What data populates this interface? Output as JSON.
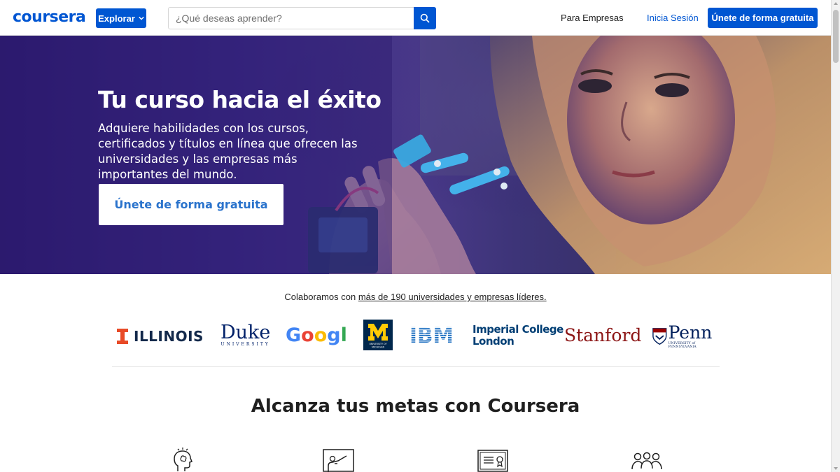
{
  "header": {
    "logo_text": "coursera",
    "explore_label": "Explorar",
    "search_placeholder": "¿Qué deseas aprender?",
    "nav_business": "Para Empresas",
    "nav_login": "Inicia Sesión",
    "join_label": "Únete de forma gratuita"
  },
  "hero": {
    "title": "Tu curso hacia el éxito",
    "subtitle": "Adquiere habilidades con los cursos, certificados y títulos en línea que ofrecen las universidades y las empresas más importantes del mundo.",
    "cta_label": "Únete de forma gratuita"
  },
  "partners": {
    "intro": "Colaboramos con ",
    "link_text": "más de 190 universidades y empresas líderes.",
    "logos": [
      {
        "name": "illinois",
        "text": "ILLINOIS",
        "mark": "I"
      },
      {
        "name": "duke",
        "text": "Duke",
        "subtext": "UNIVERSITY"
      },
      {
        "name": "google",
        "text": "Google"
      },
      {
        "name": "michigan",
        "mark": "M",
        "subtext": "UNIVERSITY OF MICHIGAN"
      },
      {
        "name": "ibm",
        "text": "IBM"
      },
      {
        "name": "imperial",
        "line1": "Imperial College",
        "line2": "London"
      },
      {
        "name": "stanford",
        "text": "Stanford"
      },
      {
        "name": "penn",
        "text": "Penn",
        "subtext": "UNIVERSITY of PENNSYLVANIA"
      }
    ]
  },
  "goals": {
    "title": "Alcanza tus metas con Coursera"
  },
  "features": [
    {
      "icon": "head-idea-icon"
    },
    {
      "icon": "instructor-board-icon"
    },
    {
      "icon": "certificate-icon"
    },
    {
      "icon": "group-people-icon"
    }
  ],
  "colors": {
    "brand_blue": "#0056d2",
    "cta_text": "#2a73cc",
    "hero_purple": "#3b2a86",
    "illinois_orange": "#e84a27",
    "illinois_navy": "#13294b",
    "duke_blue": "#012169",
    "michigan_maize": "#ffcb05",
    "michigan_blue": "#00274c",
    "ibm_blue": "#1f70c1",
    "imperial_navy": "#003e74",
    "stanford_red": "#8c1515",
    "penn_blue": "#011f5b"
  }
}
